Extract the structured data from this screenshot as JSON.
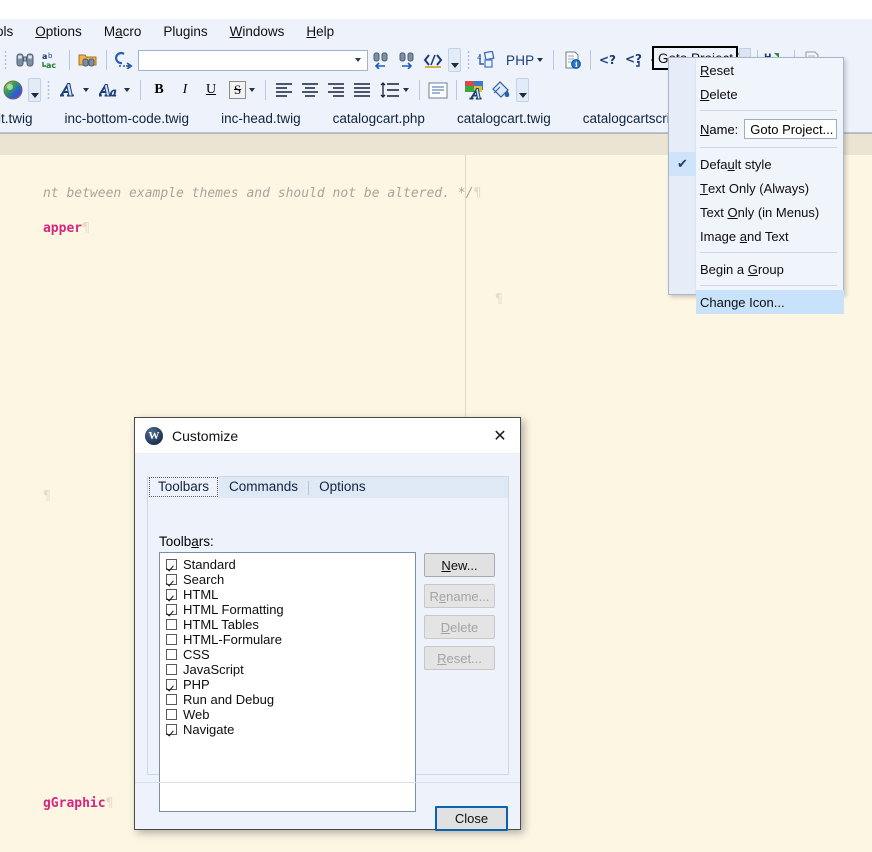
{
  "menubar": {
    "items": [
      {
        "label": "ols",
        "clipped": true
      },
      {
        "label": "Options"
      },
      {
        "label": "Macro"
      },
      {
        "label": "Plugins"
      },
      {
        "label": "Windows"
      },
      {
        "label": "Help"
      }
    ]
  },
  "toolbar_row1": {
    "find_icon": "binoculars-icon",
    "replace_icon": "find-replace-icon",
    "find_in_files_icon": "find-in-folder-icon",
    "goto_line_icon": "goto-line-icon",
    "search_value": "",
    "search_placeholder": "",
    "find_prev_icon": "find-previous-icon",
    "find_next_icon": "find-next-icon",
    "find_selected_icon": "find-selected-icon",
    "php_label": "PHP",
    "php_block_icon": "php-block-icon",
    "info_icon": "document-info-icon",
    "php_open_icon": "php-open-tag-icon",
    "php_open_close_icon": "php-open-close-tag-icon",
    "php_echo_icon": "php-echo-tag-icon",
    "new_doc_icon": "new-php-document-icon",
    "new_doc_alert_icon": "new-php-document-alert-icon",
    "comment_icon": "comment-balloon-icon",
    "html_to_php_icon": "html-to-php-icon",
    "validate_icon": "validate-document-icon",
    "goto_project_label": "Goto Project..."
  },
  "toolbar_row2": {
    "color_picker_icon": "color-wheel-icon",
    "font_icon": "font-icon",
    "font_style_icon": "font-style-icon",
    "bold_label": "B",
    "italic_label": "I",
    "underline_label": "U",
    "strike_label": "S",
    "align_left_icon": "align-left-icon",
    "align_center_icon": "align-center-icon",
    "align_right_icon": "align-right-icon",
    "align_justify_icon": "align-justify-icon",
    "line_spacing_icon": "line-spacing-icon",
    "paragraph_icon": "paragraph-format-icon",
    "text_color_icon": "text-color-icon",
    "fill_color_icon": "fill-color-icon"
  },
  "file_tabs": [
    {
      "label": "lt.twig",
      "clipped": true
    },
    {
      "label": "inc-bottom-code.twig"
    },
    {
      "label": "inc-head.twig"
    },
    {
      "label": "catalogcart.php"
    },
    {
      "label": "catalogcart.twig"
    },
    {
      "label": "catalogcartscript.twig"
    }
  ],
  "editor": {
    "comment_line": "nt between example themes and should not be altered. */",
    "tag_line_1": "apper",
    "tag_line_2": "gGraphic",
    "pilcrow": "¶"
  },
  "context_menu": {
    "items": [
      {
        "id": "reset",
        "label": "Reset",
        "accel": "R",
        "type": "item"
      },
      {
        "id": "delete",
        "label": "Delete",
        "accel": "D",
        "type": "item"
      },
      {
        "type": "sep"
      },
      {
        "id": "name",
        "type": "name",
        "label": "Name:",
        "accel": "N",
        "value": "Goto Project..."
      },
      {
        "type": "sep"
      },
      {
        "id": "default-style",
        "label": "Default style",
        "accel": "u",
        "type": "item",
        "checked": true
      },
      {
        "id": "text-only-always",
        "label": "Text Only (Always)",
        "accel": "T",
        "type": "item"
      },
      {
        "id": "text-only-menus",
        "label": "Text Only (in Menus)",
        "accel": "O",
        "type": "item"
      },
      {
        "id": "image-and-text",
        "label": "Image and Text",
        "accel": "a",
        "type": "item"
      },
      {
        "type": "sep"
      },
      {
        "id": "begin-group",
        "label": "Begin a Group",
        "accel": "G",
        "type": "item"
      },
      {
        "type": "sep"
      },
      {
        "id": "change-icon",
        "label": "Change Icon...",
        "type": "item",
        "highlight": true
      }
    ],
    "check_glyph": "✔"
  },
  "dialog": {
    "title": "Customize",
    "logo_letter": "W",
    "close_glyph": "✕",
    "tabs": [
      {
        "label": "Toolbars",
        "active": true
      },
      {
        "label": "Commands",
        "active": false
      },
      {
        "label": "Options",
        "active": false
      }
    ],
    "toolbars_label": "Toolbars:",
    "toolbars": [
      {
        "label": "Standard",
        "checked": true
      },
      {
        "label": "Search",
        "checked": true
      },
      {
        "label": "HTML",
        "checked": true
      },
      {
        "label": "HTML Formatting",
        "checked": true
      },
      {
        "label": "HTML Tables",
        "checked": false
      },
      {
        "label": "HTML-Formulare",
        "checked": false
      },
      {
        "label": "CSS",
        "checked": false
      },
      {
        "label": "JavaScript",
        "checked": false
      },
      {
        "label": "PHP",
        "checked": true
      },
      {
        "label": "Run and Debug",
        "checked": false
      },
      {
        "label": "Web",
        "checked": false
      },
      {
        "label": "Navigate",
        "checked": true
      }
    ],
    "buttons": {
      "new": "New...",
      "rename": "Rename...",
      "delete": "Delete",
      "reset": "Reset...",
      "close": "Close"
    }
  },
  "colors": {
    "chrome": "#eef3fb",
    "editor_bg": "#fdf6e3",
    "editor_band": "#ece4d2",
    "accent_highlight": "#c9e2fb",
    "tag_pink": "#d6267d",
    "comment_gray": "#a8a59a",
    "focus_blue": "#0a64ad"
  }
}
